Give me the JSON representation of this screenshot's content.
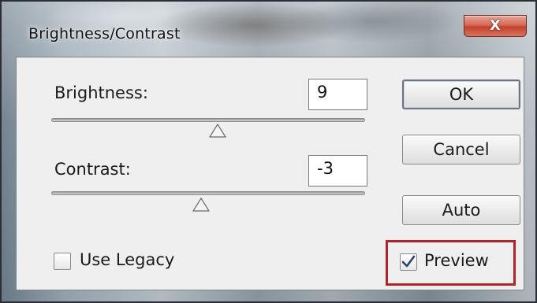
{
  "window": {
    "title": "Brightness/Contrast",
    "close_glyph": "X",
    "close_icon": "close-icon"
  },
  "brightness": {
    "label": "Brightness:",
    "value": "9",
    "slider_position": 0.53
  },
  "contrast": {
    "label": "Contrast:",
    "value": "-3",
    "slider_position": 0.47
  },
  "buttons": {
    "ok": "OK",
    "cancel": "Cancel",
    "auto": "Auto"
  },
  "options": {
    "use_legacy_label": "Use Legacy",
    "use_legacy_checked": false,
    "preview_label": "Preview",
    "preview_checked": true
  },
  "colors": {
    "highlight": "#b0252c",
    "close_button": "#c2412c"
  }
}
